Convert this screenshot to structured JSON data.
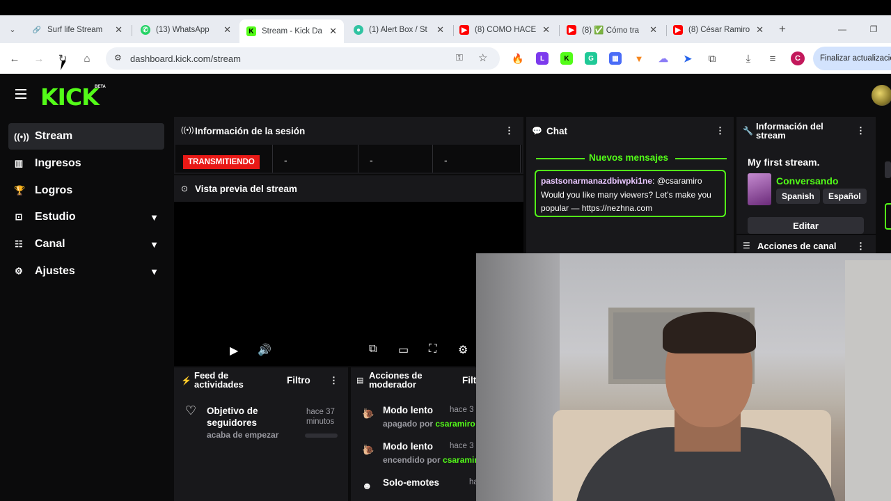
{
  "browser": {
    "tabs": [
      {
        "label": "Surf life Stream",
        "icon": "link-icon",
        "active": false
      },
      {
        "label": "(13) WhatsApp",
        "icon": "whatsapp-icon",
        "active": false
      },
      {
        "label": "Stream - Kick Da",
        "icon": "kick-icon",
        "active": true
      },
      {
        "label": "(1) Alert Box / St",
        "icon": "streamlabs-icon",
        "active": false
      },
      {
        "label": "(8) COMO HACE",
        "icon": "youtube-icon",
        "active": false
      },
      {
        "label": "(8) ✅ Cómo tra",
        "icon": "youtube-icon",
        "active": false
      },
      {
        "label": "(8) César Ramiro",
        "icon": "youtube-icon",
        "active": false
      }
    ],
    "url": "dashboard.kick.com/stream",
    "profile_initial": "C",
    "update_label": "Finalizar actualización"
  },
  "kick": {
    "logo": "KICK",
    "beta": "BETA",
    "sidebar": [
      {
        "label": "Stream",
        "icon": "broadcast-icon",
        "active": true
      },
      {
        "label": "Ingresos",
        "icon": "chart-icon"
      },
      {
        "label": "Logros",
        "icon": "trophy-icon"
      },
      {
        "label": "Estudio",
        "icon": "studio-icon",
        "expandable": true
      },
      {
        "label": "Canal",
        "icon": "users-icon",
        "expandable": true
      },
      {
        "label": "Ajustes",
        "icon": "gear-icon",
        "expandable": true
      }
    ],
    "session": {
      "title": "Información de la sesión",
      "status": "TRANSMITIENDO",
      "stats": [
        "-",
        "-",
        "-"
      ],
      "preview_title": "Vista previa del stream"
    },
    "chat": {
      "title": "Chat",
      "new_messages": "Nuevos mensajes",
      "message": {
        "user": "pastsonarmanazdbiwpki1ne",
        "text": ": @csaramiro Would you like many viewers? Let's make you popular — https://nezhna.com"
      }
    },
    "stream_info": {
      "title": "Información del stream",
      "stream_title": "My first stream.",
      "category": "Conversando",
      "tags": [
        "Spanish",
        "Español"
      ],
      "edit_label": "Editar"
    },
    "channel_actions": {
      "title": "Acciones de canal"
    },
    "activity_feed": {
      "title": "Feed de actividades",
      "filter": "Filtro",
      "item": {
        "title": "Objetivo de seguidores",
        "subtitle": "acaba de empezar",
        "time": "hace 37 minutos",
        "progress": 0
      }
    },
    "mod_actions": {
      "title": "Acciones de moderador",
      "filter": "Filt",
      "items": [
        {
          "action": "Modo lento",
          "detail": "apagado por ",
          "user": "csaramiro",
          "time": "hace 3"
        },
        {
          "action": "Modo lento",
          "detail": "encendido por ",
          "user": "csaramiro",
          "time": "hace 3"
        },
        {
          "action": "Solo-emotes",
          "detail": "",
          "user": "",
          "time": "ha"
        }
      ]
    }
  },
  "colors": {
    "kick_green": "#53fc18",
    "live_red": "#e91916",
    "panel_bg": "#18181b"
  }
}
